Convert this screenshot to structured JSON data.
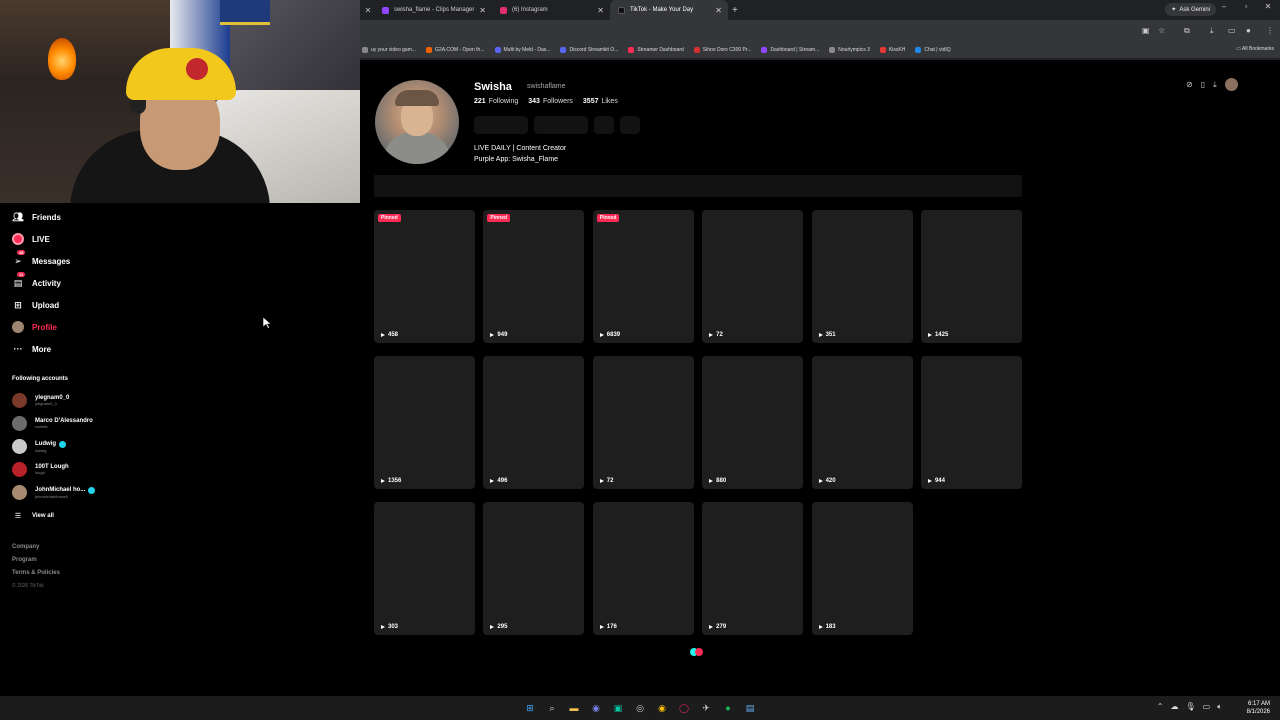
{
  "browser": {
    "tabs": [
      {
        "title": "swisha_flame - Clips Manager",
        "color": "#9146ff",
        "active": false
      },
      {
        "title": "(6) Instagram",
        "color": "#e1306c",
        "active": false
      },
      {
        "title": "TikTok - Make Your Day",
        "color": "#111111",
        "active": true
      }
    ],
    "gemini_label": "Ask Gemini",
    "bookmarks": [
      {
        "label": "uy your video gam...",
        "color": "#888888"
      },
      {
        "label": "G2A.COM - Open th...",
        "color": "#f05f00"
      },
      {
        "label": "Multi by Meld - Das...",
        "color": "#5865f2"
      },
      {
        "label": "Discord Streamkit O...",
        "color": "#5865f2"
      },
      {
        "label": "Streamer Dashboard",
        "color": "#fe2c55"
      },
      {
        "label": "Sihoo Doro C300 Pr...",
        "color": "#d32f2f"
      },
      {
        "label": "Dashboard | Stream...",
        "color": "#9146ff"
      },
      {
        "label": "Nourlympics 3",
        "color": "#888888"
      },
      {
        "label": "KissKH",
        "color": "#e53935"
      },
      {
        "label": "Chat | vidIQ",
        "color": "#1e88e5"
      }
    ],
    "all_bookmarks": "All Bookmarks"
  },
  "sidebar": {
    "nav": [
      {
        "label": "Friends",
        "icon": "friends-icon"
      },
      {
        "label": "LIVE",
        "icon": "live-icon"
      },
      {
        "label": "Messages",
        "icon": "messages-icon",
        "badge": "48"
      },
      {
        "label": "Activity",
        "icon": "activity-icon",
        "badge": "11"
      },
      {
        "label": "Upload",
        "icon": "upload-icon"
      },
      {
        "label": "Profile",
        "icon": "profile-icon"
      },
      {
        "label": "More",
        "icon": "more-icon"
      }
    ],
    "following_title": "Following accounts",
    "accounts": [
      {
        "name": "ylegnam0_0",
        "handle": "ylegnam0_0",
        "verified": false,
        "color": "#7a3a2a"
      },
      {
        "name": "Marco D'Alessandro",
        "handle": "codelis",
        "verified": false,
        "color": "#6c6c6c"
      },
      {
        "name": "Ludwig",
        "handle": "ludwig",
        "verified": true,
        "color": "#c9c9c9"
      },
      {
        "name": "100T Lough",
        "handle": "lough",
        "verified": false,
        "color": "#b8202a"
      },
      {
        "name": "JohnMichael ho...",
        "handle": "johnmichaelhowell",
        "verified": true,
        "color": "#a88a70"
      }
    ],
    "view_all": "View all",
    "footer": [
      "Company",
      "Program",
      "Terms & Policies"
    ],
    "copyright": "© 2026 TikTok"
  },
  "profile": {
    "name": "Swisha",
    "handle": "swishaflame",
    "following": "221",
    "following_label": "Following",
    "followers": "343",
    "followers_label": "Followers",
    "likes": "3557",
    "likes_label": "Likes",
    "bio_line1": "LIVE DAILY | Content Creator",
    "bio_line2": "Purple App: Swisha_Flame"
  },
  "videos": [
    {
      "views": "458",
      "pinned": true
    },
    {
      "views": "949",
      "pinned": true
    },
    {
      "views": "6839",
      "pinned": true
    },
    {
      "views": "72",
      "pinned": false
    },
    {
      "views": "351",
      "pinned": false
    },
    {
      "views": "1425",
      "pinned": false
    },
    {
      "views": "1356",
      "pinned": false
    },
    {
      "views": "496",
      "pinned": false
    },
    {
      "views": "72",
      "pinned": false
    },
    {
      "views": "880",
      "pinned": false
    },
    {
      "views": "420",
      "pinned": false
    },
    {
      "views": "944",
      "pinned": false
    },
    {
      "views": "303",
      "pinned": false
    },
    {
      "views": "295",
      "pinned": false
    },
    {
      "views": "176",
      "pinned": false
    },
    {
      "views": "279",
      "pinned": false
    },
    {
      "views": "183",
      "pinned": false
    }
  ],
  "pinned_label": "Pinned",
  "taskbar": {
    "time": "6:17 AM",
    "date": "8/1/2026"
  }
}
